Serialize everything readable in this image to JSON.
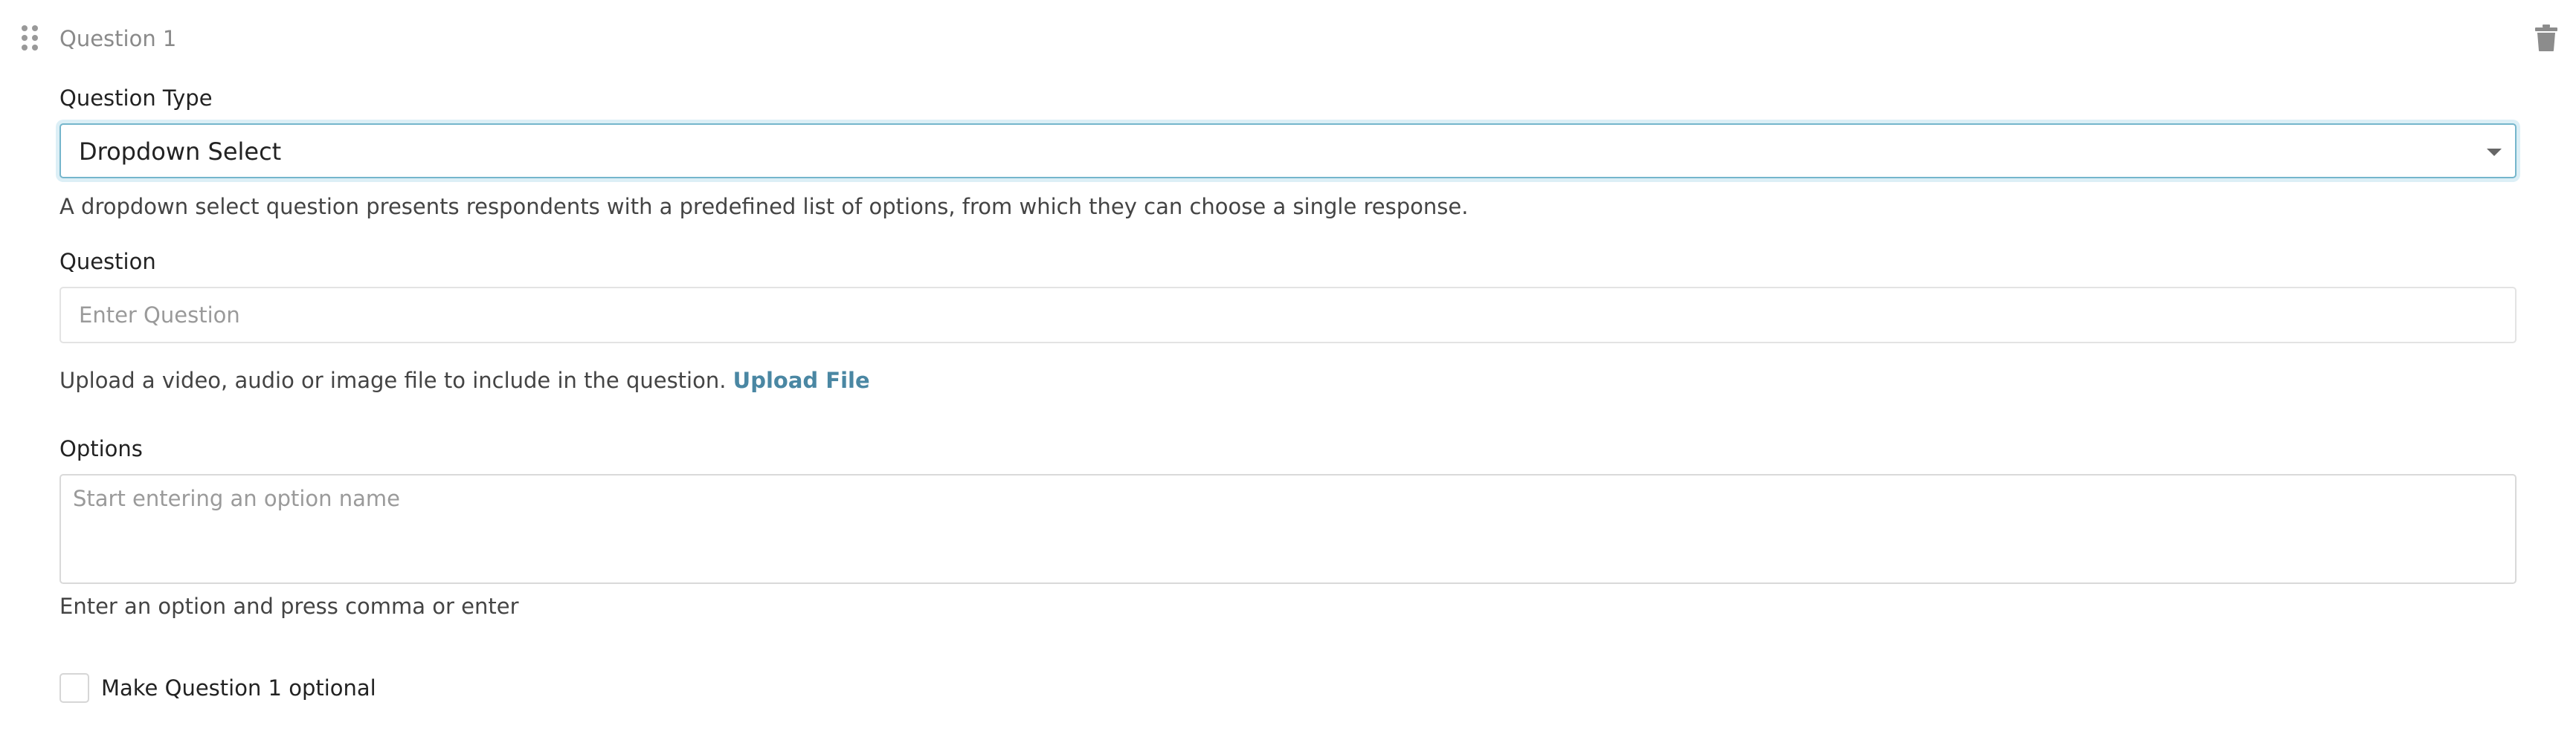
{
  "header": {
    "question_title": "Question 1",
    "drag_icon": "drag-handle-icon",
    "delete_icon": "trash-icon"
  },
  "question_type": {
    "label": "Question Type",
    "selected": "Dropdown Select",
    "description": "A dropdown select question presents respondents with a predefined list of options, from which they can choose a single response."
  },
  "question": {
    "label": "Question",
    "value": "",
    "placeholder": "Enter Question",
    "upload_text": "Upload a video, audio or image file to include in the question.",
    "upload_link": "Upload File"
  },
  "options": {
    "label": "Options",
    "value": "",
    "placeholder": "Start entering an option name",
    "help": "Enter an option and press comma or enter"
  },
  "optional": {
    "checked": false,
    "label": "Make Question 1 optional"
  },
  "colors": {
    "accent": "#4a87a3",
    "focus_border": "#75b6cc"
  }
}
